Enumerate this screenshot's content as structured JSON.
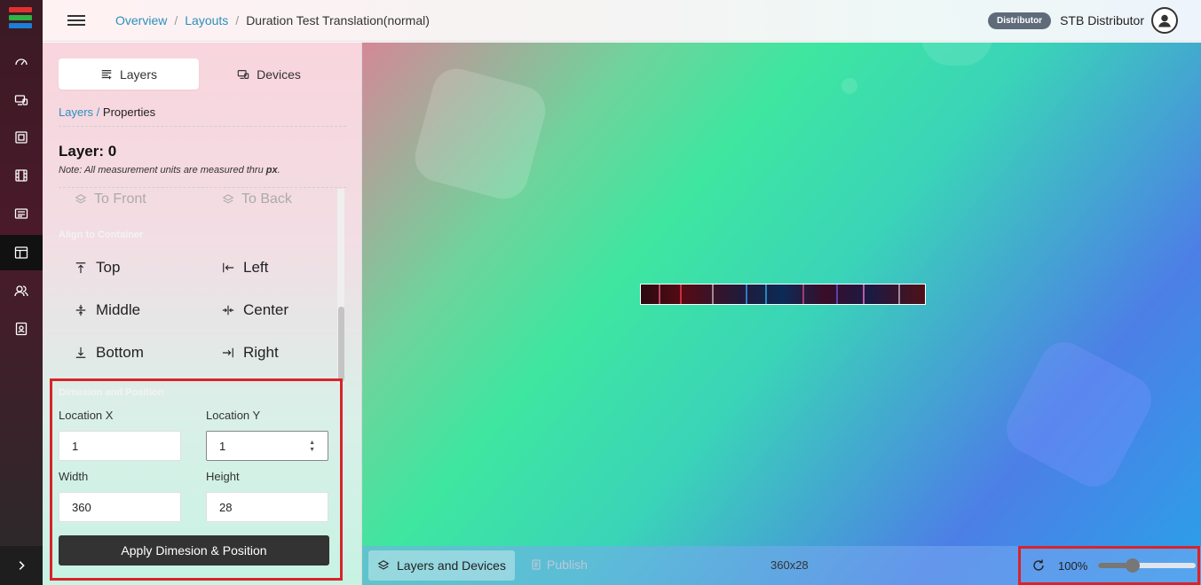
{
  "header": {
    "breadcrumb": [
      "Overview",
      "Layouts",
      "Duration Test Translation(normal)"
    ],
    "role_badge": "Distributor",
    "user_name": "STB Distributor"
  },
  "rail": {
    "icons": [
      "dashboard-icon",
      "devices-icon",
      "media-icon",
      "film-icon",
      "playlist-icon",
      "layouts-icon",
      "users-icon",
      "contacts-icon"
    ],
    "active": "layouts-icon",
    "logo_colors": [
      "#e03131",
      "#2fb344",
      "#1c7ed6"
    ]
  },
  "panel": {
    "tabs": [
      "Layers",
      "Devices"
    ],
    "crumb_link": "Layers",
    "crumb_sep": "/",
    "crumb_current": "Properties",
    "title": "Layer: 0",
    "note_prefix": "Note: All measurement units are measured thru ",
    "note_unit": "px",
    "note_suffix": ".",
    "to_front": "To Front",
    "to_back": "To Back",
    "align_heading": "Align to Container",
    "align": [
      "Top",
      "Left",
      "Middle",
      "Center",
      "Bottom",
      "Right"
    ],
    "dim_heading": "Dimesion and Position",
    "fields": {
      "loc_x_label": "Location X",
      "loc_x": "1",
      "loc_y_label": "Location Y",
      "loc_y": "1",
      "width_label": "Width",
      "width": "360",
      "height_label": "Height",
      "height": "28"
    },
    "apply": "Apply Dimesion & Position"
  },
  "canvas": {
    "layers_devices": "Layers and Devices",
    "publish": "Publish",
    "size": "360x28",
    "zoom": "100%",
    "zoom_level": 0.35
  }
}
